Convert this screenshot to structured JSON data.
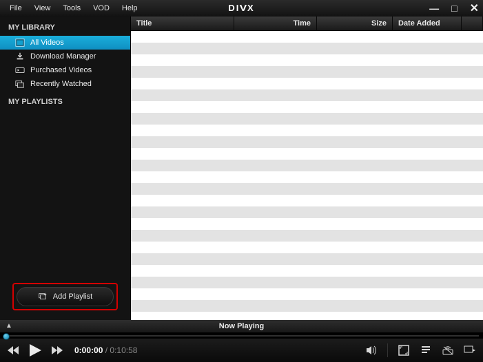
{
  "app": {
    "logo": "DIVX"
  },
  "menu": {
    "file": "File",
    "view": "View",
    "tools": "Tools",
    "vod": "VOD",
    "help": "Help"
  },
  "window_controls": {
    "minimize": "—",
    "maximize": "□",
    "close": "✕"
  },
  "sidebar": {
    "library_title": "MY LIBRARY",
    "items": [
      {
        "label": "All Videos"
      },
      {
        "label": "Download Manager"
      },
      {
        "label": "Purchased Videos"
      },
      {
        "label": "Recently Watched"
      }
    ],
    "playlists_title": "MY PLAYLISTS",
    "add_playlist_label": "Add Playlist"
  },
  "columns": {
    "title": "Title",
    "time": "Time",
    "size": "Size",
    "date_added": "Date Added"
  },
  "now_playing": {
    "label": "Now Playing"
  },
  "player": {
    "elapsed": "0:00:00",
    "separator": " / ",
    "duration": "0:10:58"
  }
}
